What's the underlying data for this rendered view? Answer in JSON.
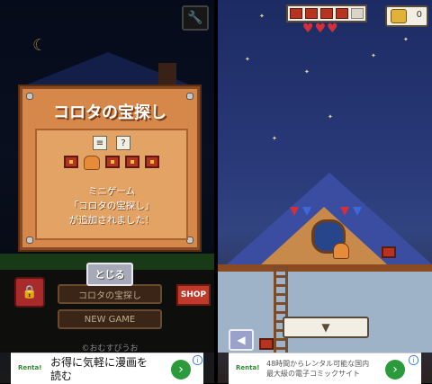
{
  "left_screen": {
    "dialog": {
      "title": "コロタの宝探し",
      "unknown_marker": "?",
      "message_line1": "ミニゲーム",
      "message_line2": "「コロタの宝探し」",
      "message_line3": "が追加されました！",
      "close_label": "とじる"
    },
    "menu": {
      "secondary_label": "コロタの宝探し",
      "new_game_label": "NEW GAME",
      "shop_label": "SHOP"
    },
    "copyright": "©おむすびうお"
  },
  "right_screen": {
    "coin_count": "0",
    "hearts": 3,
    "collected_chests": 4,
    "chest_slots": 5
  },
  "ads": [
    {
      "logo": "Renta!",
      "text_line1": "お得に気軽に漫画を",
      "text_line2": "読む"
    },
    {
      "logo": "Renta!",
      "text_line1": "48時間からレンタル可能な国内",
      "text_line2": "最大級の電子コミックサイト"
    }
  ],
  "colors": {
    "dialog_wood": "#d6874a",
    "heart": "#d22f3a",
    "ad_arrow": "#2a9a3a"
  }
}
